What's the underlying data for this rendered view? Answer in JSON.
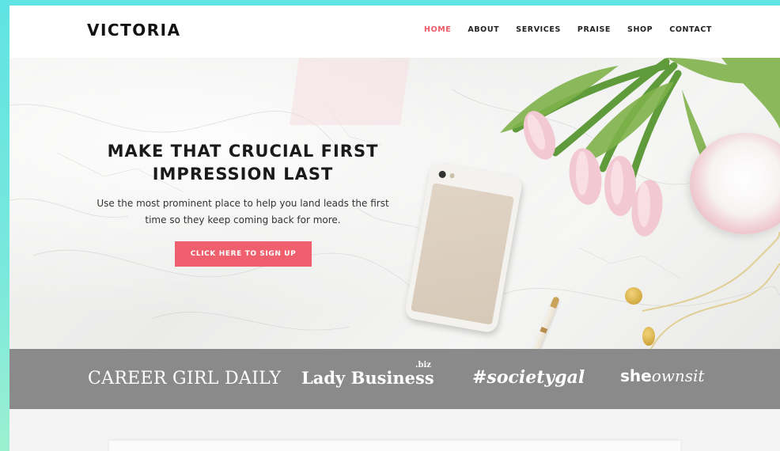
{
  "site": {
    "logo": "VICTORIA"
  },
  "nav": {
    "items": [
      {
        "label": "HOME",
        "active": true
      },
      {
        "label": "ABOUT",
        "active": false
      },
      {
        "label": "SERVICES",
        "active": false
      },
      {
        "label": "PRAISE",
        "active": false
      },
      {
        "label": "SHOP",
        "active": false
      },
      {
        "label": "CONTACT",
        "active": false
      }
    ]
  },
  "hero": {
    "title_line1": "MAKE THAT CRUCIAL FIRST",
    "title_line2": "IMPRESSION LAST",
    "subtitle_line1": "Use the most prominent place to help you land leads the first",
    "subtitle_line2": "time so they keep coming back for more.",
    "cta_label": "CLICK HERE TO SIGN UP"
  },
  "press": {
    "logo1": "CAREER GIRL DAILY",
    "logo2": "Lady Business",
    "logo2_suffix": ".biz",
    "logo3": "#societygal",
    "logo4_a": "she",
    "logo4_b": "ownsit"
  },
  "colors": {
    "accent": "#ef5b66",
    "cta": "#f05f6d",
    "press_bar": "#8a8a8a",
    "outer_background": "#5fe3e3"
  }
}
